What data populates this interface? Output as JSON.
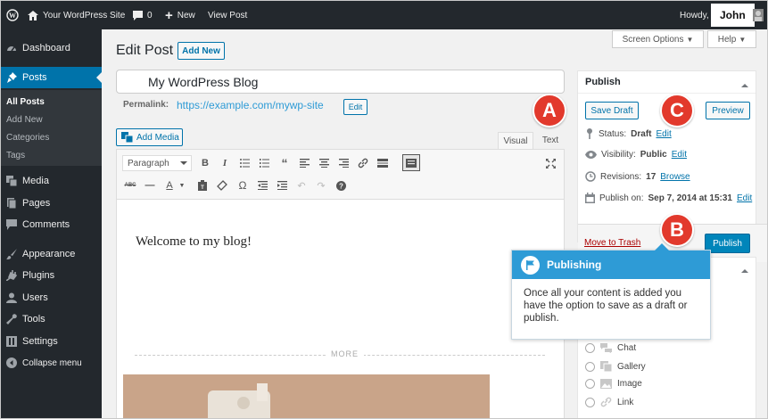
{
  "admin_bar": {
    "site_name": "Your WordPress Site",
    "comment_count": "0",
    "new_label": "New",
    "view_post": "View Post",
    "howdy": "Howdy,",
    "user": "John"
  },
  "sidebar": {
    "items": [
      {
        "label": "Dashboard",
        "icon": "dashboard-icon"
      },
      {
        "label": "Posts",
        "icon": "pin-icon",
        "active": true
      },
      {
        "label": "Media",
        "icon": "media-icon"
      },
      {
        "label": "Pages",
        "icon": "pages-icon"
      },
      {
        "label": "Comments",
        "icon": "comment-icon"
      },
      {
        "label": "Appearance",
        "icon": "brush-icon"
      },
      {
        "label": "Plugins",
        "icon": "plugin-icon"
      },
      {
        "label": "Users",
        "icon": "users-icon"
      },
      {
        "label": "Tools",
        "icon": "wrench-icon"
      },
      {
        "label": "Settings",
        "icon": "settings-icon"
      },
      {
        "label": "Collapse menu",
        "icon": "collapse-icon"
      }
    ],
    "submenu": [
      "All Posts",
      "Add New",
      "Categories",
      "Tags"
    ]
  },
  "screen_options": "Screen Options",
  "help": "Help",
  "page_title": "Edit Post",
  "add_new": "Add New",
  "post_title": "My WordPress Blog",
  "permalink_label": "Permalink:",
  "permalink_url": "https://example.com/mywp-site",
  "permalink_edit": "Edit",
  "add_media": "Add Media",
  "tabs": {
    "visual": "Visual",
    "text": "Text"
  },
  "format_select": "Paragraph",
  "content": "Welcome to my blog!",
  "more": "MORE",
  "publish_box": {
    "title": "Publish",
    "save_draft": "Save Draft",
    "preview": "Preview",
    "status_label": "Status:",
    "status_value": "Draft",
    "visibility_label": "Visibility:",
    "visibility_value": "Public",
    "revisions_label": "Revisions:",
    "revisions_value": "17",
    "browse": "Browse",
    "publish_on_label": "Publish on:",
    "publish_on_value": "Sep 7, 2014 at 15:31",
    "edit": "Edit",
    "move_to_trash": "Move to Trash",
    "publish": "Publish"
  },
  "formats": [
    "Chat",
    "Gallery",
    "Image",
    "Link"
  ],
  "tooltip": {
    "title": "Publishing",
    "body": "Once all your content is added you have the option to save as a draft or publish."
  },
  "markers": {
    "a": "A",
    "b": "B",
    "c": "C"
  },
  "colors": {
    "accent": "#0073aa",
    "marker": "#e2392c",
    "tooltip": "#2e9bd6",
    "sidebar": "#23282d"
  }
}
